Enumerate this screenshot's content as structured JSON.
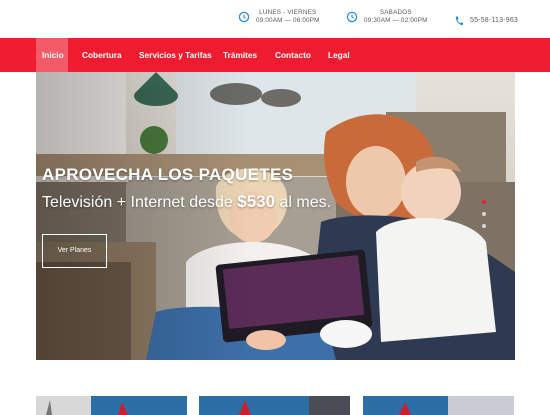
{
  "header": {
    "weekday": {
      "label": "LUNES - VIERNES",
      "hours": "09:00AM — 06:00PM",
      "icon": "clock-icon"
    },
    "saturday": {
      "label": "SABADOS",
      "hours": "09:30AM — 02:00PM",
      "icon": "clock-icon"
    },
    "phone": {
      "number": "55-58-113-963",
      "icon": "phone-icon"
    },
    "accent_color": "#2f8ed8"
  },
  "nav": {
    "color": "#ee1c2e",
    "items": [
      {
        "label": "Inicio",
        "active": true
      },
      {
        "label": "Cobertura",
        "active": false
      },
      {
        "label": "Servicios y Tarifas",
        "active": false
      },
      {
        "label": "Trámites",
        "active": false
      },
      {
        "label": "Contacto",
        "active": false
      },
      {
        "label": "Legal",
        "active": false
      }
    ]
  },
  "hero": {
    "title": "APROVECHA LOS PAQUETES",
    "subtitle_pre": "Televisión + Internet desde ",
    "subtitle_price": "$530",
    "subtitle_post": " al mes.",
    "button_label": "Ver Planes",
    "slides": 3,
    "active_slide": 1
  }
}
